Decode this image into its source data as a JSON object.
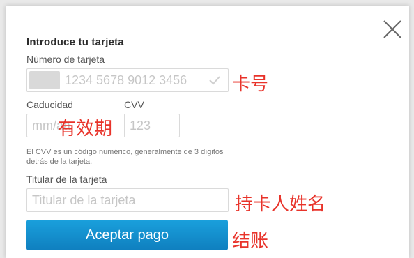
{
  "form": {
    "title": "Introduce tu tarjeta",
    "card_number_label": "Número de tarjeta",
    "card_number_placeholder": "1234 5678 9012 3456",
    "expiry_label": "Caducidad",
    "expiry_placeholder": "mm/aa",
    "cvv_label": "CVV",
    "cvv_placeholder": "123",
    "cvv_help": "El CVV es un código numérico, generalmente de 3 dígitos detrás de la tarjeta.",
    "holder_label": "Titular de la tarjeta",
    "holder_placeholder": "Titular de la tarjeta",
    "submit_label": "Aceptar pago"
  },
  "annotations": {
    "card_number": "卡号",
    "expiry": "有效期",
    "holder": "持卡人姓名",
    "checkout": "结账"
  },
  "colors": {
    "button": "#1592d0",
    "annotation": "#e8332a"
  }
}
